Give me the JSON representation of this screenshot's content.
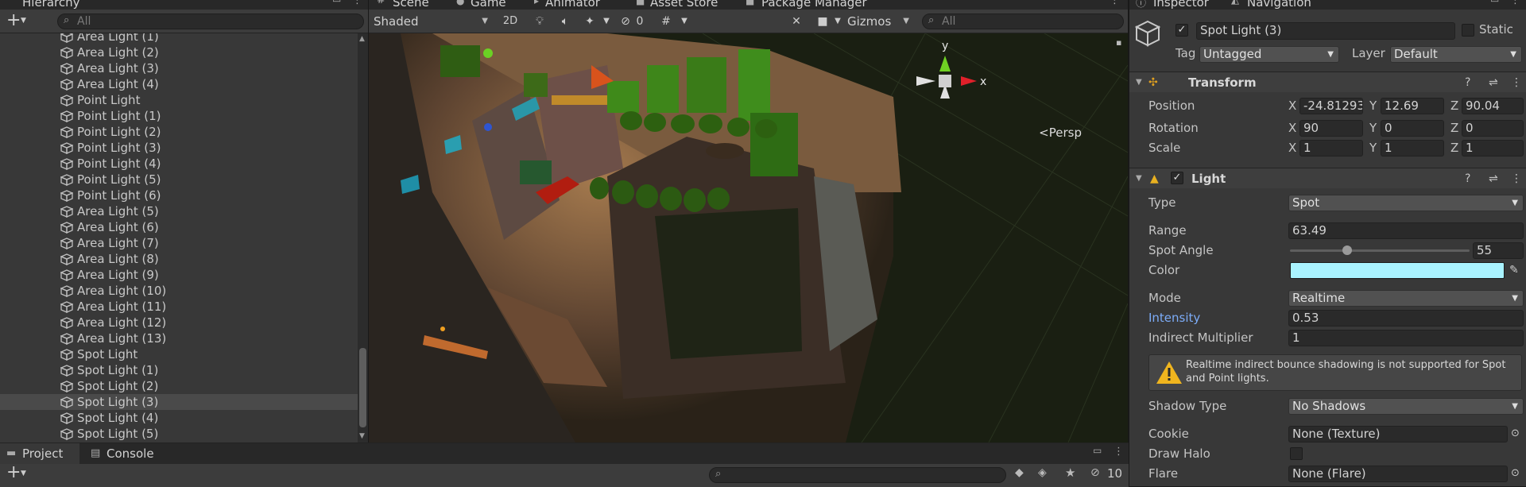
{
  "hierarchy": {
    "tab_label": "Hierarchy",
    "add_label": "+",
    "search_placeholder": "All",
    "items": [
      {
        "label": "Area Light (1)"
      },
      {
        "label": "Area Light (2)"
      },
      {
        "label": "Area Light (3)"
      },
      {
        "label": "Area Light (4)"
      },
      {
        "label": "Point Light"
      },
      {
        "label": "Point Light (1)"
      },
      {
        "label": "Point Light (2)"
      },
      {
        "label": "Point Light (3)"
      },
      {
        "label": "Point Light (4)"
      },
      {
        "label": "Point Light (5)"
      },
      {
        "label": "Point Light (6)"
      },
      {
        "label": "Area Light (5)"
      },
      {
        "label": "Area Light (6)"
      },
      {
        "label": "Area Light (7)"
      },
      {
        "label": "Area Light (8)"
      },
      {
        "label": "Area Light (9)"
      },
      {
        "label": "Area Light (10)"
      },
      {
        "label": "Area Light (11)"
      },
      {
        "label": "Area Light (12)"
      },
      {
        "label": "Area Light (13)"
      },
      {
        "label": "Spot Light"
      },
      {
        "label": "Spot Light (1)"
      },
      {
        "label": "Spot Light (2)"
      },
      {
        "label": "Spot Light (3)",
        "selected": true
      },
      {
        "label": "Spot Light (4)"
      },
      {
        "label": "Spot Light (5)"
      }
    ]
  },
  "scene": {
    "tabs": [
      "Scene",
      "Game",
      "Animator",
      "Asset Store",
      "Package Manager"
    ],
    "shading_mode": "Shaded",
    "mode_2d": "2D",
    "hidden_count": "0",
    "gizmos_label": "Gizmos",
    "search_placeholder": "All",
    "persp_label": "Persp",
    "gizmo_axes": {
      "y": "y",
      "x": "x"
    }
  },
  "bottom": {
    "tabs": [
      "Project",
      "Console"
    ],
    "add_label": "+",
    "hidden_count": "10"
  },
  "inspector": {
    "tabs": [
      "Inspector",
      "Navigation"
    ],
    "object_name": "Spot Light (3)",
    "static_label": "Static",
    "tag_label": "Tag",
    "tag_value": "Untagged",
    "layer_label": "Layer",
    "layer_value": "Default",
    "transform": {
      "title": "Transform",
      "position": {
        "label": "Position",
        "x": "-24.81293",
        "y": "12.69",
        "z": "90.04"
      },
      "rotation": {
        "label": "Rotation",
        "x": "90",
        "y": "0",
        "z": "0"
      },
      "scale": {
        "label": "Scale",
        "x": "1",
        "y": "1",
        "z": "1"
      }
    },
    "light": {
      "title": "Light",
      "type_label": "Type",
      "type_value": "Spot",
      "range_label": "Range",
      "range_value": "63.49",
      "spot_angle_label": "Spot Angle",
      "spot_angle_value": "55",
      "spot_angle_fraction": 0.32,
      "color_label": "Color",
      "color_value": "#a9f3ff",
      "mode_label": "Mode",
      "mode_value": "Realtime",
      "intensity_label": "Intensity",
      "intensity_value": "0.53",
      "indirect_label": "Indirect Multiplier",
      "indirect_value": "1",
      "warning": "Realtime indirect bounce shadowing is not supported for Spot and Point lights.",
      "shadow_label": "Shadow Type",
      "shadow_value": "No Shadows",
      "cookie_label": "Cookie",
      "cookie_value": "None (Texture)",
      "draw_halo_label": "Draw Halo",
      "flare_label": "Flare",
      "flare_value": "None (Flare)"
    }
  },
  "colors": {
    "accent_blue": "#7cacf8",
    "selection": "#4a4a4a",
    "panel": "#383838"
  }
}
